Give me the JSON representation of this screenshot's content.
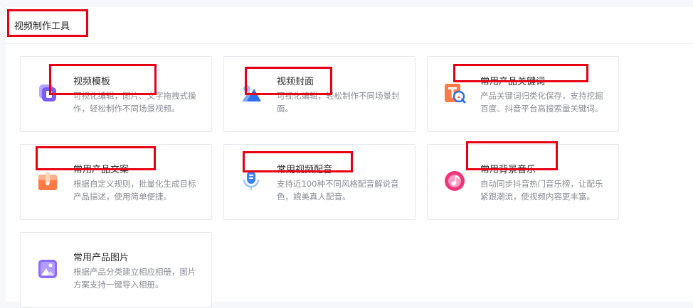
{
  "panel": {
    "title": "视频制作工具"
  },
  "tools": [
    {
      "title": "视频模板",
      "desc": "可视化编辑，图片、文字拖拽式操作，轻松制作不同场景视频。",
      "icon": "video-template-icon"
    },
    {
      "title": "视频封面",
      "desc": "可视化编辑，轻松制作不同场景封面。",
      "icon": "video-cover-icon"
    },
    {
      "title": "常用产品关键词",
      "desc": "产品关键词归类化保存，支持挖掘百度、抖音平台高搜索量关键词。",
      "icon": "keyword-icon"
    },
    {
      "title": "常用产品文案",
      "desc": "根据自定义规则，批量化生成目标产品描述，使用简单便捷。",
      "icon": "copywriting-icon"
    },
    {
      "title": "常用视频配音",
      "desc": "支持近100种不同风格配音解说音色，媲美真人配音。",
      "icon": "microphone-icon"
    },
    {
      "title": "常用背景音乐",
      "desc": "自动同步抖音热门音乐榜，让配乐紧跟潮流，使视频内容更丰富。",
      "icon": "music-icon"
    },
    {
      "title": "常用产品图片",
      "desc": "根据产品分类建立相应相册，图片方案支持一键导入相册。",
      "icon": "image-icon"
    }
  ],
  "colors": {
    "highlight": "#e60012",
    "accent_purple": "#7b5cf5",
    "accent_blue": "#3b82f6",
    "accent_orange": "#ff7a45",
    "accent_pink": "#f0357a"
  }
}
